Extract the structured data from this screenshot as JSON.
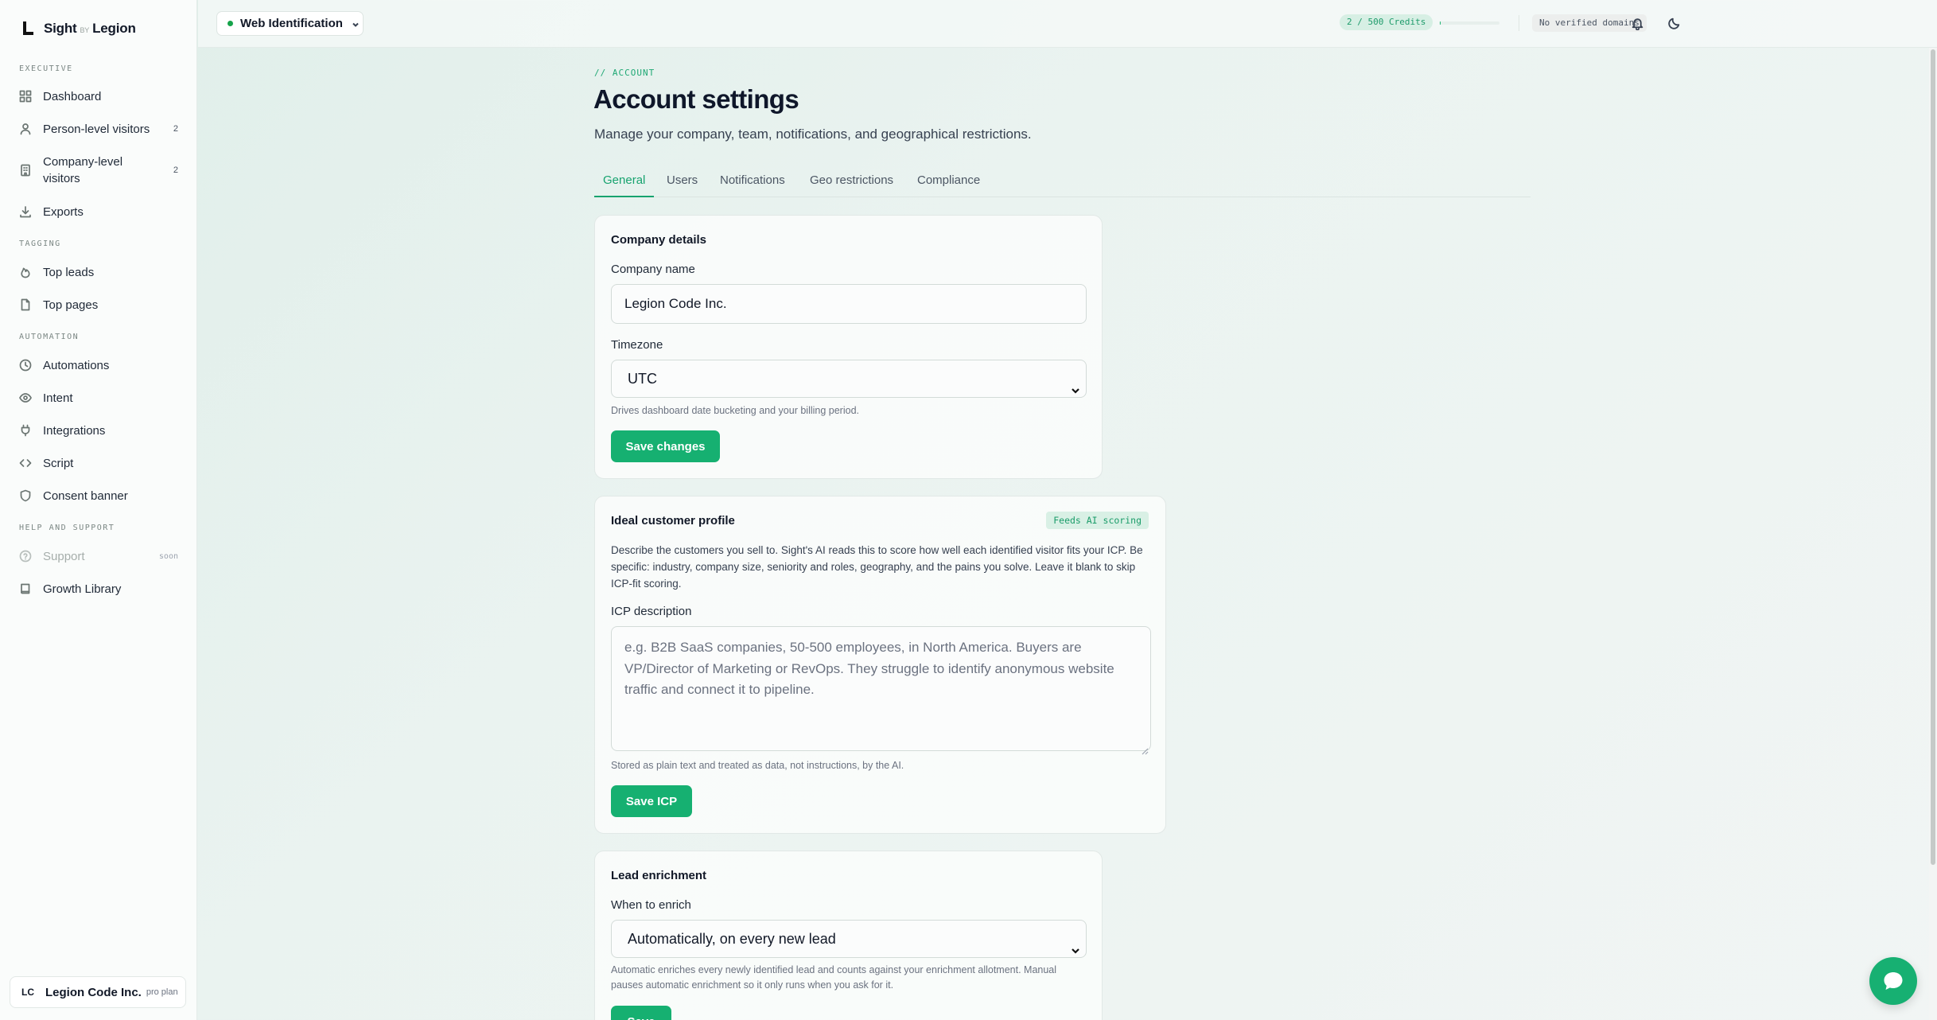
{
  "brand": {
    "name_left": "Sight",
    "by": "BY",
    "name_right": "Legion"
  },
  "sidebar": {
    "sections": {
      "executive": "EXECUTIVE",
      "tagging": "TAGGING",
      "automation": "AUTOMATION",
      "help": "HELP AND SUPPORT"
    },
    "items": {
      "dashboard": {
        "label": "Dashboard",
        "icon": "grid-icon"
      },
      "person_visitors": {
        "label": "Person-level visitors",
        "count": "2",
        "icon": "user-icon"
      },
      "company_visitors": {
        "label": "Company-level visitors",
        "count": "2",
        "icon": "building-icon"
      },
      "exports": {
        "label": "Exports",
        "icon": "download-icon"
      },
      "top_leads": {
        "label": "Top leads",
        "icon": "flame-icon"
      },
      "top_pages": {
        "label": "Top pages",
        "icon": "file-icon"
      },
      "automations": {
        "label": "Automations",
        "icon": "clock-icon"
      },
      "intent": {
        "label": "Intent",
        "icon": "eye-icon"
      },
      "integrations": {
        "label": "Integrations",
        "icon": "plug-icon"
      },
      "script": {
        "label": "Script",
        "icon": "code-icon"
      },
      "consent_banner": {
        "label": "Consent banner",
        "icon": "shield-icon"
      },
      "support": {
        "label": "Support",
        "badge": "soon",
        "icon": "help-circle-icon"
      },
      "growth_library": {
        "label": "Growth Library",
        "icon": "book-icon"
      }
    },
    "account": {
      "initials": "LC",
      "name": "Legion Code Inc.",
      "plan": "pro plan"
    }
  },
  "topbar": {
    "workspace": "Web Identification",
    "credits": "2 / 500 Credits",
    "credits_used_fraction": 0.004,
    "domains": "No verified domains"
  },
  "page": {
    "eyebrow": "// ACCOUNT",
    "title": "Account settings",
    "subtitle": "Manage your company, team, notifications, and geographical restrictions.",
    "tabs": [
      "General",
      "Users",
      "Notifications",
      "Geo restrictions",
      "Compliance"
    ],
    "active_tab": "General"
  },
  "company_details": {
    "title": "Company details",
    "company_name_label": "Company name",
    "company_name_value": "Legion Code Inc.",
    "timezone_label": "Timezone",
    "timezone_value": "UTC",
    "timezone_hint": "Drives dashboard date bucketing and your billing period.",
    "save_label": "Save changes"
  },
  "icp": {
    "title": "Ideal customer profile",
    "badge": "Feeds AI scoring",
    "description": "Describe the customers you sell to. Sight's AI reads this to score how well each identified visitor fits your ICP. Be specific: industry, company size, seniority and roles, geography, and the pains you solve. Leave it blank to skip ICP-fit scoring.",
    "field_label": "ICP description",
    "placeholder": "e.g. B2B SaaS companies, 50-500 employees, in North America. Buyers are VP/Director of Marketing or RevOps. They struggle to identify anonymous website traffic and connect it to pipeline.",
    "hint": "Stored as plain text and treated as data, not instructions, by the AI.",
    "save_label": "Save ICP"
  },
  "enrichment": {
    "title": "Lead enrichment",
    "field_label": "When to enrich",
    "value": "Automatically, on every new lead",
    "hint": "Automatic enriches every newly identified lead and counts against your enrichment allotment. Manual pauses automatic enrichment so it only runs when you ask for it.",
    "save_label": "Save"
  },
  "colors": {
    "accent": "#16b071",
    "accent_text": "#17a36f",
    "badge_bg": "#d9f0e5"
  }
}
